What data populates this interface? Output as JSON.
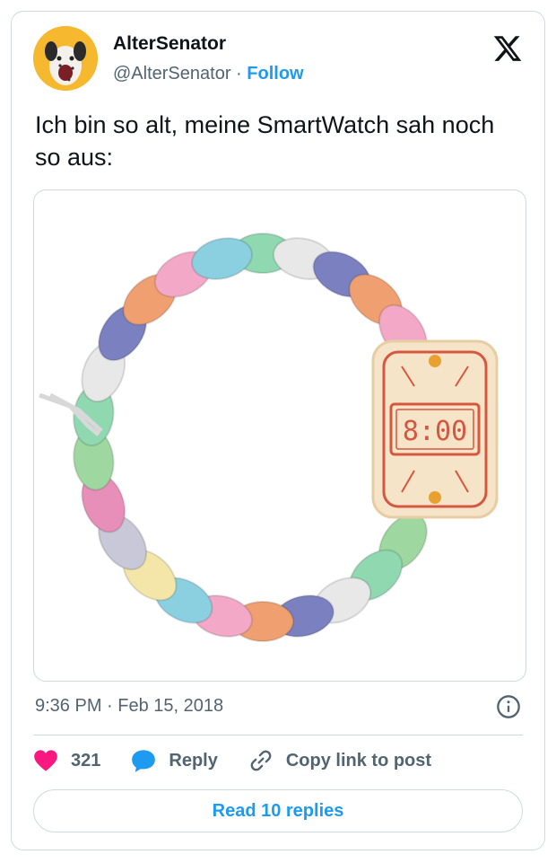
{
  "author": {
    "name": "AlterSenator",
    "handle": "@AlterSenator",
    "separator": "·",
    "follow_label": "Follow"
  },
  "tweet": {
    "text": "Ich bin so alt, meine SmartWatch sah noch so aus:",
    "timestamp": "9:36 PM · Feb 15, 2018",
    "watch_display": "8:00"
  },
  "actions": {
    "like_count": "321",
    "reply_label": "Reply",
    "copy_link_label": "Copy link to post"
  },
  "read_replies_label": "Read 10 replies",
  "colors": {
    "accent": "#1d9bf0",
    "like": "#f91880",
    "muted": "#536471",
    "border": "#cfd9de"
  }
}
